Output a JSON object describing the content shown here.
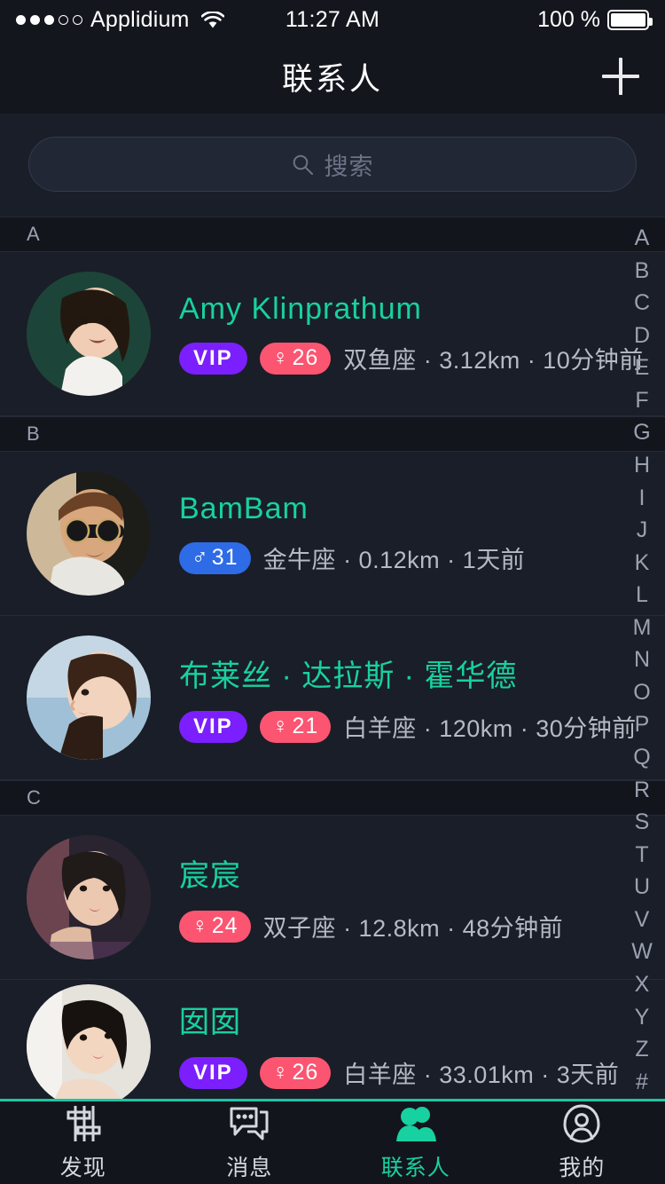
{
  "status_bar": {
    "signal_dots_filled": 3,
    "signal_dots_total": 5,
    "carrier": "Applidium",
    "wifi_icon": "wifi-icon",
    "time": "11:27 AM",
    "battery_percent": "100 %",
    "battery_icon": "battery-full-icon"
  },
  "nav": {
    "title": "联系人",
    "add_icon": "plus-icon"
  },
  "search": {
    "icon": "search-icon",
    "placeholder": "搜索",
    "value": ""
  },
  "colors": {
    "accent_teal": "#18d1a0",
    "vip_purple": "#7b1fff",
    "female_pink": "#fb5571",
    "male_blue": "#2e6be6",
    "background": "#1a1e28",
    "section_background": "#12151c",
    "meta_text": "#b5bac4"
  },
  "sections": [
    {
      "letter": "A",
      "contacts": [
        {
          "name": "Amy Klinprathum",
          "vip": true,
          "vip_label": "VIP",
          "gender": "female",
          "gender_symbol": "♀",
          "age": "26",
          "zodiac": "双鱼座",
          "distance": "3.12km",
          "last_active": "10分钟前",
          "meta": "双鱼座 · 3.12km · 10分钟前",
          "avatar": "avatar-amy"
        }
      ]
    },
    {
      "letter": "B",
      "contacts": [
        {
          "name": "BamBam",
          "vip": false,
          "vip_label": "",
          "gender": "male",
          "gender_symbol": "♂",
          "age": "31",
          "zodiac": "金牛座",
          "distance": "0.12km",
          "last_active": "1天前",
          "meta": "金牛座 · 0.12km · 1天前",
          "avatar": "avatar-bambam"
        },
        {
          "name": "布莱丝 · 达拉斯 · 霍华德",
          "vip": true,
          "vip_label": "VIP",
          "gender": "female",
          "gender_symbol": "♀",
          "age": "21",
          "zodiac": "白羊座",
          "distance": "120km",
          "last_active": "30分钟前",
          "meta": "白羊座 · 120km · 30分钟前",
          "avatar": "avatar-bryce"
        }
      ]
    },
    {
      "letter": "C",
      "contacts": [
        {
          "name": "宸宸",
          "vip": false,
          "vip_label": "",
          "gender": "female",
          "gender_symbol": "♀",
          "age": "24",
          "zodiac": "双子座",
          "distance": "12.8km",
          "last_active": "48分钟前",
          "meta": "双子座 · 12.8km · 48分钟前",
          "avatar": "avatar-chenchen"
        },
        {
          "name": "囡囡",
          "vip": true,
          "vip_label": "VIP",
          "gender": "female",
          "gender_symbol": "♀",
          "age": "26",
          "zodiac": "白羊座",
          "distance": "33.01km",
          "last_active": "3天前",
          "meta": "白羊座 · 33.01km · 3天前",
          "avatar": "avatar-nannan"
        }
      ]
    }
  ],
  "index_bar": [
    "A",
    "B",
    "C",
    "D",
    "E",
    "F",
    "G",
    "H",
    "I",
    "J",
    "K",
    "L",
    "M",
    "N",
    "O",
    "P",
    "Q",
    "R",
    "S",
    "T",
    "U",
    "V",
    "W",
    "X",
    "Y",
    "Z",
    "#"
  ],
  "tabs": [
    {
      "label": "发现",
      "icon": "discover-sliders-icon",
      "active": false
    },
    {
      "label": "消息",
      "icon": "chat-bubbles-icon",
      "active": false
    },
    {
      "label": "联系人",
      "icon": "contacts-people-icon",
      "active": true
    },
    {
      "label": "我的",
      "icon": "profile-person-icon",
      "active": false
    }
  ]
}
